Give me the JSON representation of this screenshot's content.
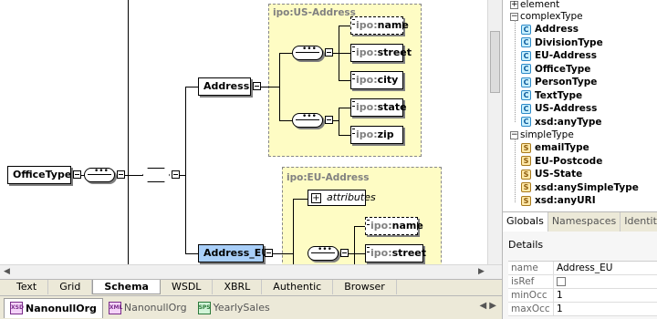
{
  "diagram": {
    "groups": [
      {
        "name": "group-us-address",
        "prefix": "ipo:",
        "label": "US-Address"
      },
      {
        "name": "group-eu-address",
        "prefix": "ipo:",
        "label": "EU-Address"
      }
    ],
    "elements": {
      "office_type": "OfficeType",
      "address": "Address",
      "address_eu": "Address_EU",
      "us_name": {
        "prefix": "ipo:",
        "label": "name"
      },
      "us_street": {
        "prefix": "ipo:",
        "label": "street"
      },
      "us_city": {
        "prefix": "ipo:",
        "label": "city"
      },
      "us_state": {
        "prefix": "ipo:",
        "label": "state"
      },
      "us_zip": {
        "prefix": "ipo:",
        "label": "zip"
      },
      "eu_name": {
        "prefix": "ipo:",
        "label": "name"
      },
      "eu_street": {
        "prefix": "ipo:",
        "label": "street"
      },
      "attributes": "attributes"
    }
  },
  "view_tabs": [
    {
      "label": "Text",
      "active": false
    },
    {
      "label": "Grid",
      "active": false
    },
    {
      "label": "Schema",
      "active": true
    },
    {
      "label": "WSDL",
      "active": false
    },
    {
      "label": "XBRL",
      "active": false
    },
    {
      "label": "Authentic",
      "active": false
    },
    {
      "label": "Browser",
      "active": false
    }
  ],
  "doc_tabs": [
    {
      "label": "NanonullOrg",
      "active": true,
      "icon": "xsd-file-icon"
    },
    {
      "label": "NanonullOrg",
      "active": false,
      "icon": "xml-file-icon"
    },
    {
      "label": "YearlySales",
      "active": false,
      "icon": "sps-file-icon"
    }
  ],
  "tree": {
    "element_label": "element",
    "complex_label": "complexType",
    "complex_items": [
      "Address",
      "DivisionType",
      "EU-Address",
      "OfficeType",
      "PersonType",
      "TextType",
      "US-Address",
      "xsd:anyType"
    ],
    "simple_label": "simpleType",
    "simple_items": [
      "emailType",
      "EU-Postcode",
      "US-State",
      "xsd:anySimpleType",
      "xsd:anyURI"
    ]
  },
  "panel_tabs": [
    "Globals",
    "Namespaces",
    "Identity"
  ],
  "details": {
    "title": "Details",
    "rows": [
      {
        "name": "name",
        "value": "Address_EU"
      },
      {
        "name": "isRef",
        "value": ""
      },
      {
        "name": "minOcc",
        "value": "1"
      },
      {
        "name": "maxOcc",
        "value": "1"
      }
    ]
  },
  "colors": {
    "group_fill": "#fefcc4",
    "selected_element": "#a8cef8",
    "complex_icon": "#c8f0ff",
    "simple_icon": "#ffe8a8"
  }
}
